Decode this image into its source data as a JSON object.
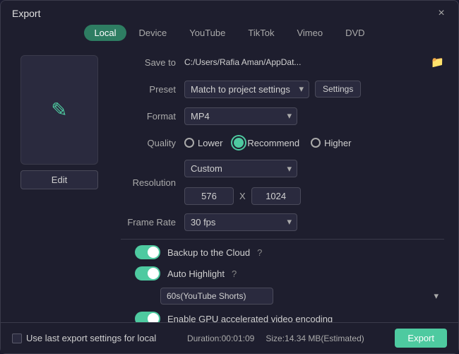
{
  "window": {
    "title": "Export",
    "close_label": "×"
  },
  "tabs": [
    {
      "id": "local",
      "label": "Local",
      "active": true
    },
    {
      "id": "device",
      "label": "Device",
      "active": false
    },
    {
      "id": "youtube",
      "label": "YouTube",
      "active": false
    },
    {
      "id": "tiktok",
      "label": "TikTok",
      "active": false
    },
    {
      "id": "vimeo",
      "label": "Vimeo",
      "active": false
    },
    {
      "id": "dvd",
      "label": "DVD",
      "active": false
    }
  ],
  "preview": {
    "edit_label": "Edit",
    "icon": "✎"
  },
  "form": {
    "save_to_label": "Save to",
    "save_to_path": "C:/Users/Rafia Aman/AppDat...",
    "preset_label": "Preset",
    "preset_value": "Match to project settings",
    "settings_btn": "Settings",
    "format_label": "Format",
    "format_value": "MP4",
    "quality_label": "Quality",
    "quality_options": [
      "Lower",
      "Recommend",
      "Higher"
    ],
    "quality_selected": "Recommend",
    "resolution_label": "Resolution",
    "resolution_value": "Custom",
    "resolution_w": "576",
    "resolution_x": "X",
    "resolution_h": "1024",
    "frame_rate_label": "Frame Rate",
    "frame_rate_value": "30 fps"
  },
  "toggles": {
    "backup_label": "Backup to the Cloud",
    "auto_highlight_label": "Auto Highlight",
    "gpu_label": "Enable GPU accelerated video encoding",
    "shorts_value": "60s(YouTube Shorts)"
  },
  "bottom": {
    "use_last_label": "Use last export settings for local",
    "duration_label": "Duration:00:01:09",
    "size_label": "Size:14.34 MB(Estimated)",
    "export_label": "Export"
  }
}
